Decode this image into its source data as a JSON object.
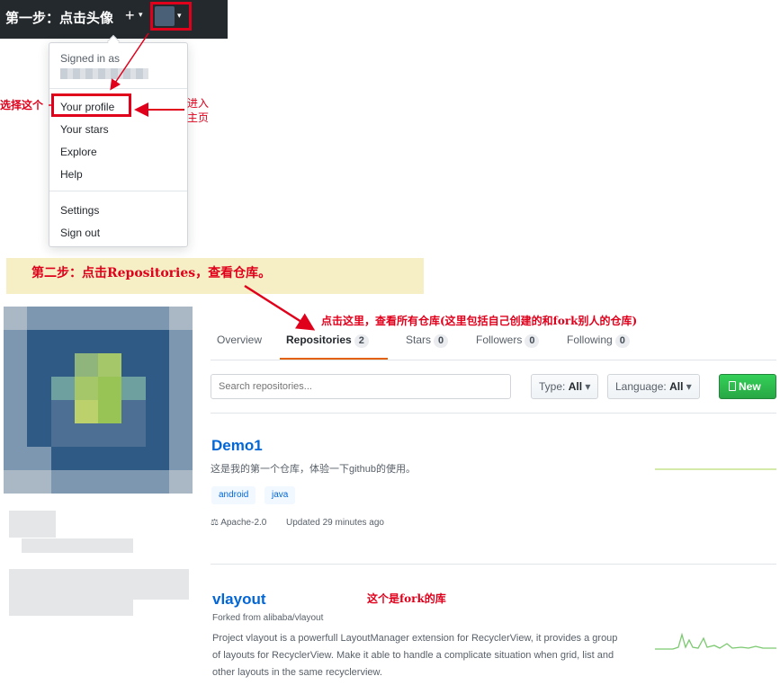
{
  "annotations": {
    "step1": "第一步：点击头像",
    "select_this": "选择这个",
    "enter_home": "进入主页",
    "step2": "第二步：点击Repositories，查看仓库。",
    "click_here": "点击这里，查看所有仓库(这里包括自己创建的和fork别人的仓库)",
    "fork_note": "这个是fork的库"
  },
  "header": {
    "plus_icon": "+",
    "caret": "▾"
  },
  "menu": {
    "signed_in_as": "Signed in as",
    "items": [
      "Your profile",
      "Your stars",
      "Explore",
      "Help",
      "Settings",
      "Sign out"
    ]
  },
  "tabs": [
    {
      "label": "Overview",
      "count": null
    },
    {
      "label": "Repositories",
      "count": "2"
    },
    {
      "label": "Stars",
      "count": "0"
    },
    {
      "label": "Followers",
      "count": "0"
    },
    {
      "label": "Following",
      "count": "0"
    }
  ],
  "filters": {
    "search_placeholder": "Search repositories...",
    "type_label": "Type:",
    "type_value": "All",
    "language_label": "Language:",
    "language_value": "All",
    "new_button": "New"
  },
  "repos": [
    {
      "name": "Demo1",
      "description": "这是我的第一个仓库，体验一下github的使用。",
      "topics": [
        "android",
        "java"
      ],
      "license": "Apache-2.0",
      "updated": "Updated 29 minutes ago"
    },
    {
      "name": "vlayout",
      "forked_from": "Forked from alibaba/vlayout",
      "description": "Project vlayout is a powerfull LayoutManager extension for RecyclerView, it provides a group of layouts for RecyclerView. Make it able to handle a complicate situation when grid, list and other layouts in the same recyclerview."
    }
  ],
  "colors": {
    "accent_red": "#e0001b",
    "link_blue": "#0366d6",
    "tab_underline": "#e36209",
    "new_green": "#28a745"
  }
}
